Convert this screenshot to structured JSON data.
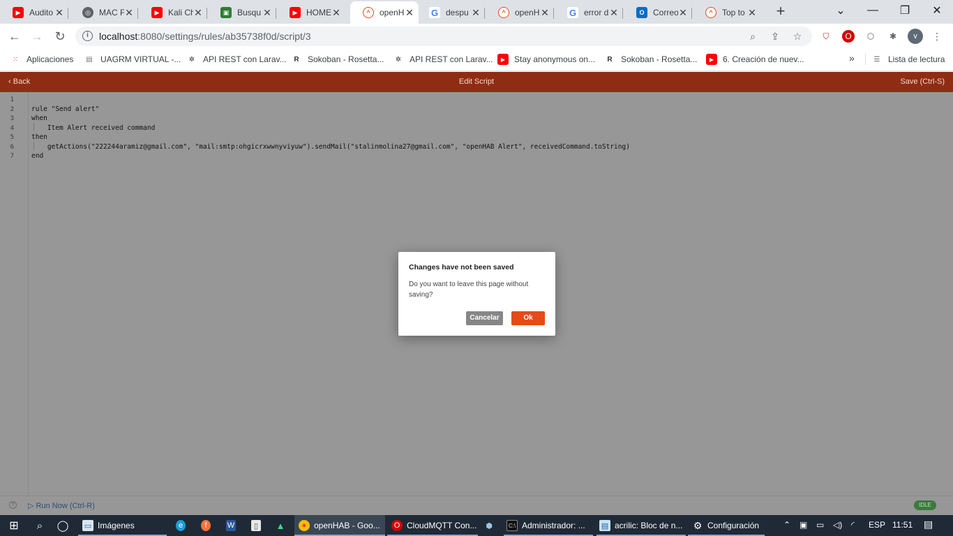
{
  "tabs": [
    {
      "title": "Audito",
      "icon": "youtube-icon",
      "color": "#ff0000"
    },
    {
      "title": "MAC F",
      "icon": "globe-icon",
      "color": "#5f6368"
    },
    {
      "title": "Kali Ch",
      "icon": "youtube-icon",
      "color": "#ff0000"
    },
    {
      "title": "Busqu",
      "icon": "app-icon",
      "color": "#2e7d32"
    },
    {
      "title": "HOME",
      "icon": "youtube-icon",
      "color": "#ff0000"
    },
    {
      "title": "openH",
      "icon": "openhab-icon",
      "color": "#e64a19"
    },
    {
      "title": "despu",
      "icon": "google-icon",
      "color": "#4285f4"
    },
    {
      "title": "openH",
      "icon": "openhab-icon",
      "color": "#e64a19"
    },
    {
      "title": "error d",
      "icon": "google-icon",
      "color": "#4285f4"
    },
    {
      "title": "Correo",
      "icon": "outlook-icon",
      "color": "#0f6cbd"
    },
    {
      "title": "Top to",
      "icon": "openhab-icon",
      "color": "#e64a19"
    }
  ],
  "url": {
    "host": "localhost",
    "path": ":8080/settings/rules/ab35738f0d/script/3"
  },
  "bookmarks": [
    {
      "label": "Aplicaciones",
      "icon": "apps-grid-icon"
    },
    {
      "label": "UAGRM VIRTUAL -...",
      "icon": "uagrm-icon"
    },
    {
      "label": "API REST con Larav...",
      "icon": "laravel-icon"
    },
    {
      "label": "Sokoban - Rosetta...",
      "icon": "rosetta-icon"
    },
    {
      "label": "API REST con Larav...",
      "icon": "laravel-icon"
    },
    {
      "label": "Stay anonymous on...",
      "icon": "youtube-icon"
    },
    {
      "label": "Sokoban - Rosetta...",
      "icon": "rosetta-icon"
    },
    {
      "label": "6. Creación de nuev...",
      "icon": "youtube-icon"
    }
  ],
  "bookmarks_more": "»",
  "reading_list": "Lista de lectura",
  "header": {
    "back": "Back",
    "title": "Edit Script",
    "save": "Save (Ctrl-S)"
  },
  "code_lines": [
    {
      "n": "1",
      "text": ""
    },
    {
      "n": "2",
      "text": "rule \"Send alert\""
    },
    {
      "n": "3",
      "text": "when"
    },
    {
      "n": "4",
      "text": "    Item Alert received command"
    },
    {
      "n": "5",
      "text": "then"
    },
    {
      "n": "6",
      "text": "    getActions(\"222244aramiz@gmail.com\", \"mail:smtp:ohgicrxwwnyviyuw\").sendMail(\"stalinmolina27@gmail.com\", \"openHAB Alert\", receivedCommand.toString)"
    },
    {
      "n": "7",
      "text": "end"
    }
  ],
  "footer": {
    "run": "Run Now (Ctrl-R)",
    "status": "IDLE"
  },
  "dialog": {
    "title": "Changes have not been saved",
    "message": "Do you want to leave this page without saving?",
    "cancel": "Cancelar",
    "ok": "Ok"
  },
  "taskbar": {
    "items": [
      {
        "label": "Imágenes"
      },
      {
        "label": "openHAB - Goo..."
      },
      {
        "label": "CloudMQTT Con..."
      },
      {
        "label": "Administrador: ..."
      },
      {
        "label": "acrilic: Bloc de n..."
      },
      {
        "label": "Configuración"
      }
    ],
    "lang": "ESP",
    "time": "11:51"
  }
}
